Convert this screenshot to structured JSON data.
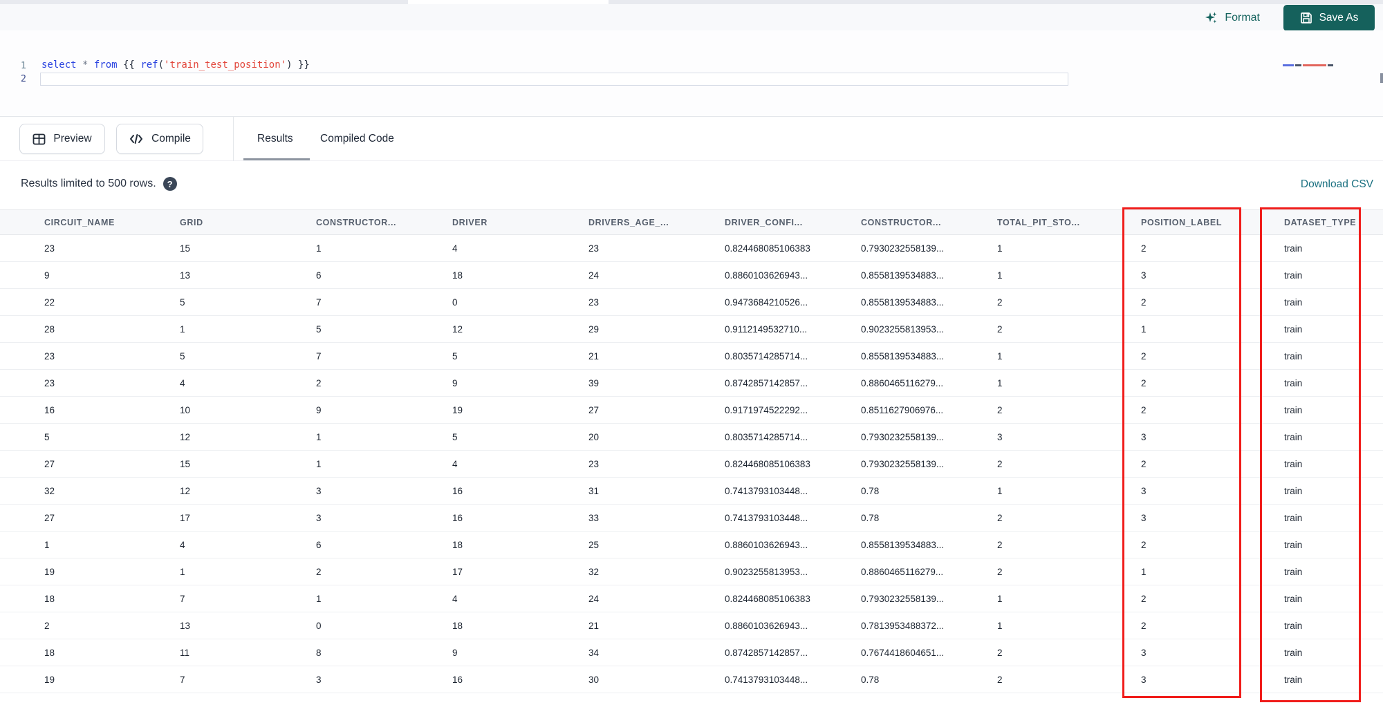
{
  "toolbar": {
    "format_label": "Format",
    "save_as_label": "Save As"
  },
  "editor": {
    "line_numbers": {
      "line1": "1",
      "line2": "2"
    },
    "tokens": [
      {
        "t": "select",
        "c": "keyword"
      },
      {
        "t": " * ",
        "c": "operator"
      },
      {
        "t": "from",
        "c": "keyword"
      },
      {
        "t": " {{ ",
        "c": "jinja"
      },
      {
        "t": "ref",
        "c": "function"
      },
      {
        "t": "(",
        "c": "jinja"
      },
      {
        "t": "'train_test_position'",
        "c": "string"
      },
      {
        "t": ")",
        "c": "jinja"
      },
      {
        "t": " }}",
        "c": "jinja"
      }
    ]
  },
  "actions": {
    "preview_label": "Preview",
    "compile_label": "Compile"
  },
  "tabs": [
    {
      "label": "Results",
      "active": true
    },
    {
      "label": "Compiled Code",
      "active": false
    }
  ],
  "results_bar": {
    "info_text": "Results limited to 500 rows.",
    "help_icon": "question-mark",
    "download_label": "Download CSV"
  },
  "table": {
    "columns": [
      "CIRCUIT_NAME",
      "GRID",
      "CONSTRUCTOR...",
      "DRIVER",
      "DRIVERS_AGE_...",
      "DRIVER_CONFI...",
      "CONSTRUCTOR...",
      "TOTAL_PIT_STO...",
      "POSITION_LABEL",
      "DATASET_TYPE"
    ],
    "highlighted_columns": [
      "POSITION_LABEL",
      "DATASET_TYPE"
    ],
    "rows": [
      [
        "23",
        "15",
        "1",
        "4",
        "23",
        "0.824468085106383",
        "0.7930232558139...",
        "1",
        "2",
        "train"
      ],
      [
        "9",
        "13",
        "6",
        "18",
        "24",
        "0.8860103626943...",
        "0.8558139534883...",
        "1",
        "3",
        "train"
      ],
      [
        "22",
        "5",
        "7",
        "0",
        "23",
        "0.9473684210526...",
        "0.8558139534883...",
        "2",
        "2",
        "train"
      ],
      [
        "28",
        "1",
        "5",
        "12",
        "29",
        "0.9112149532710...",
        "0.9023255813953...",
        "2",
        "1",
        "train"
      ],
      [
        "23",
        "5",
        "7",
        "5",
        "21",
        "0.8035714285714...",
        "0.8558139534883...",
        "1",
        "2",
        "train"
      ],
      [
        "23",
        "4",
        "2",
        "9",
        "39",
        "0.8742857142857...",
        "0.8860465116279...",
        "1",
        "2",
        "train"
      ],
      [
        "16",
        "10",
        "9",
        "19",
        "27",
        "0.9171974522292...",
        "0.8511627906976...",
        "2",
        "2",
        "train"
      ],
      [
        "5",
        "12",
        "1",
        "5",
        "20",
        "0.8035714285714...",
        "0.7930232558139...",
        "3",
        "3",
        "train"
      ],
      [
        "27",
        "15",
        "1",
        "4",
        "23",
        "0.824468085106383",
        "0.7930232558139...",
        "2",
        "2",
        "train"
      ],
      [
        "32",
        "12",
        "3",
        "16",
        "31",
        "0.7413793103448...",
        "0.78",
        "1",
        "3",
        "train"
      ],
      [
        "27",
        "17",
        "3",
        "16",
        "33",
        "0.7413793103448...",
        "0.78",
        "2",
        "3",
        "train"
      ],
      [
        "1",
        "4",
        "6",
        "18",
        "25",
        "0.8860103626943...",
        "0.8558139534883...",
        "2",
        "2",
        "train"
      ],
      [
        "19",
        "1",
        "2",
        "17",
        "32",
        "0.9023255813953...",
        "0.8860465116279...",
        "2",
        "1",
        "train"
      ],
      [
        "18",
        "7",
        "1",
        "4",
        "24",
        "0.824468085106383",
        "0.7930232558139...",
        "1",
        "2",
        "train"
      ],
      [
        "2",
        "13",
        "0",
        "18",
        "21",
        "0.8860103626943...",
        "0.7813953488372...",
        "1",
        "2",
        "train"
      ],
      [
        "18",
        "11",
        "8",
        "9",
        "34",
        "0.8742857142857...",
        "0.7674418604651...",
        "2",
        "3",
        "train"
      ],
      [
        "19",
        "7",
        "3",
        "16",
        "30",
        "0.7413793103448...",
        "0.78",
        "2",
        "3",
        "train"
      ]
    ]
  },
  "colors": {
    "accent_teal": "#15615c",
    "link_teal": "#1a7080",
    "highlight_red": "#f01d1b",
    "keyword_blue": "#2b44e0",
    "string_red": "#e2473c",
    "header_gray": "#57606e"
  }
}
